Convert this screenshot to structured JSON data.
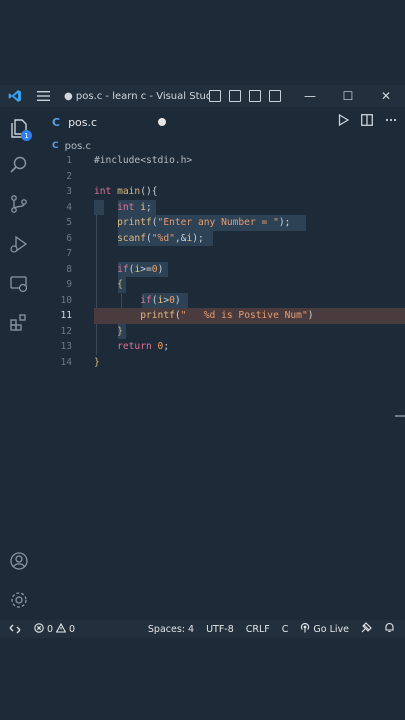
{
  "window": {
    "title": "● pos.c - learn c - Visual Studi...",
    "minimize": "—",
    "maximize": "☐",
    "close": "✕"
  },
  "tab": {
    "icon_letter": "C",
    "filename": "pos.c",
    "modified": true
  },
  "breadcrumb": {
    "icon_letter": "C",
    "file": "pos.c"
  },
  "activity_bar": {
    "explorer_badge": "1"
  },
  "editor": {
    "line_numbers": [
      "1",
      "2",
      "3",
      "4",
      "5",
      "6",
      "7",
      "8",
      "9",
      "10",
      "11",
      "12",
      "13",
      "14"
    ],
    "active_line": 11
  },
  "status_bar": {
    "errors": "0",
    "warnings": "0",
    "spaces": "Spaces: 4",
    "encoding": "UTF-8",
    "eol": "CRLF",
    "language": "C",
    "go_live": "Go Live"
  },
  "colors": {
    "background": "#1d2a37",
    "accent": "#2f80ed",
    "keyword": "#e0709a",
    "string": "#e89a6e"
  }
}
